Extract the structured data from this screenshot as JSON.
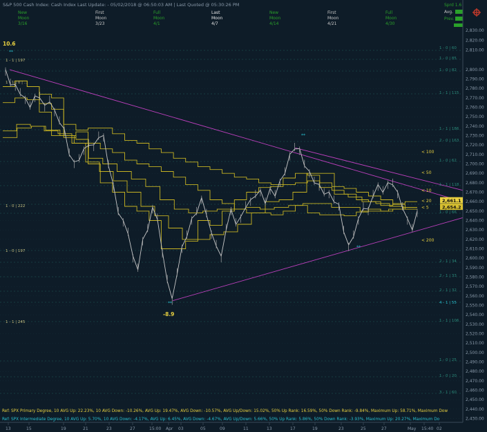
{
  "header": {
    "title": "S&P 500 Cash Index:  Cash Index  Last Update: - 05/02/2018 @ 06:50:03 AM | Last Quoted @ 05:30:26 PM",
    "right_labels": [
      "Sprd 1.6",
      "Avg.",
      "Prev."
    ]
  },
  "moon_phases": [
    {
      "phase": "New",
      "word": "Moon",
      "date": "3/16",
      "color": "#2aa02a"
    },
    {
      "phase": "First",
      "word": "Moon",
      "date": "3/23",
      "color": "#c8c8c8"
    },
    {
      "phase": "Full",
      "word": "Moon",
      "date": "4/1",
      "color": "#2aa02a"
    },
    {
      "phase": "Last",
      "word": "Moon",
      "date": "4/7",
      "color": "#e8e8e8"
    },
    {
      "phase": "New",
      "word": "Moon",
      "date": "4/14",
      "color": "#2aa02a"
    },
    {
      "phase": "First",
      "word": "Moon",
      "date": "4/21",
      "color": "#c8c8c8"
    },
    {
      "phase": "Full",
      "word": "Moon",
      "date": "4/30",
      "color": "#2aa02a"
    }
  ],
  "annotations": {
    "high_value": "10.6",
    "low_value": "-8.9",
    "ma_labels": [
      "< 100",
      "< 50",
      "< 10",
      "< 20",
      "< 5",
      "< 200"
    ],
    "price_tags": [
      "2,661.1",
      "2,654.2"
    ],
    "marker": "**"
  },
  "fib_labels": {
    "left": [
      "1 - 1 | 197",
      "1 - 1 | 0 | ...",
      "1 - 0 | 222",
      "1 - 0 | 197",
      "1 - 1 | 245"
    ],
    "right": [
      "1 - 0 | 60",
      "1 - 0 | 85",
      "1 - 0 | 82",
      "1 - 1 | 115",
      "1 - 1 | 186",
      "2 - 0 | 163",
      "1 - 0 | 62",
      "1 - 1 | 118",
      "1 - 0 | 66",
      "2 - 1 | 34",
      "2 - 1 | 33",
      "2 - 1 | 32",
      "4 - 1 | 55",
      "1 - 1 | 106",
      "1 - 0 | 25",
      "1 - 0 | 20",
      "3 - 1 | 60"
    ]
  },
  "footer": {
    "line1": "Ref: SPX Primary Degree, 10 AVG Up: 22.23%, 10 AVG Down: -10.26%, AVG Up: 19.47%, AVG Down: -10.57%, AVG Up/Down: 15.02%, 50%  Up Rank: 16.59%, 50% Down Rank: -9.84%, Maximum Up: 58.71%, Maximum Dow",
    "line2": "Ref: SPX Intermediate Degree, 10 AVG Up: 5.70%, 10 AVG Down: -4.17%, AVG Up: 6.45%, AVG Down: -4.67%, AVG Up/Down: 5.66%, 50%  Up Rank: 5.86%, 50% Down Rank: -3.93%, Maximum Up: 20.27%, Maximum Do"
  },
  "chart_data": {
    "type": "line",
    "ylim": [
      2430,
      2810
    ],
    "ytick_labels": [
      "2,800.00",
      "2,790.00",
      "2,780.00",
      "2,770.00",
      "2,760.00",
      "2,750.00",
      "2,740.00",
      "2,730.00",
      "2,720.00",
      "2,710.00",
      "2,700.00",
      "2,690.00",
      "2,680.00",
      "2,670.00",
      "2,660.00",
      "2,650.00",
      "2,640.00",
      "2,630.00",
      "2,620.00",
      "2,610.00",
      "2,600.00",
      "2,590.00",
      "2,580.00",
      "2,570.00",
      "2,560.00",
      "2,550.00",
      "2,540.00",
      "2,530.00",
      "2,520.00",
      "2,510.00",
      "2,500.00",
      "2,490.00",
      "2,480.00",
      "2,470.00",
      "2,460.00",
      "2,450.00",
      "2,440.00",
      "2,430.00"
    ],
    "yticks": [
      2800,
      2790,
      2780,
      2770,
      2760,
      2750,
      2740,
      2730,
      2720,
      2710,
      2700,
      2690,
      2680,
      2670,
      2660,
      2650,
      2640,
      2630,
      2620,
      2610,
      2600,
      2590,
      2580,
      2570,
      2560,
      2550,
      2540,
      2530,
      2520,
      2510,
      2500,
      2490,
      2480,
      2470,
      2460,
      2450,
      2440,
      2430
    ],
    "top_tick_labels": [
      "2,830.00",
      "2,820.00",
      "2,810.00"
    ],
    "top_ticks": [
      2830,
      2820,
      2810
    ],
    "xtick_labels": [
      "13",
      "15",
      "19",
      "21",
      "23",
      "27",
      "15:00",
      "Apr",
      "03",
      "05",
      "09",
      "11",
      "13",
      "17",
      "19",
      "23",
      "25",
      "27",
      "May",
      "15:40",
      "02"
    ],
    "price_series": {
      "name": "SPX",
      "values": [
        2798,
        2786,
        2782,
        2776,
        2768,
        2762,
        2770,
        2772,
        2760,
        2768,
        2755,
        2746,
        2735,
        2712,
        2700,
        2706,
        2714,
        2722,
        2718,
        2730,
        2728,
        2700,
        2676,
        2650,
        2638,
        2628,
        2600,
        2590,
        2618,
        2632,
        2652,
        2643,
        2605,
        2578,
        2555,
        2585,
        2610,
        2625,
        2640,
        2650,
        2662,
        2648,
        2625,
        2615,
        2600,
        2632,
        2650,
        2638,
        2642,
        2656,
        2660,
        2668,
        2670,
        2660,
        2672,
        2668,
        2680,
        2692,
        2708,
        2718,
        2714,
        2700,
        2690,
        2682,
        2676,
        2670,
        2668,
        2662,
        2655,
        2630,
        2612,
        2625,
        2640,
        2655,
        2650,
        2668,
        2676,
        2672,
        2678,
        2680,
        2668,
        2655,
        2640,
        2632,
        2648
      ]
    },
    "ma_series": [
      {
        "values": [
          2782,
          2788,
          2782,
          2774,
          2770,
          2742,
          2736,
          2738,
          2738,
          2732,
          2725,
          2722,
          2716,
          2712,
          2706,
          2702,
          2697,
          2694,
          2690,
          2686,
          2684,
          2680,
          2678,
          2678,
          2680,
          2682,
          2680,
          2676,
          2674,
          2670,
          2666,
          2662,
          2657,
          2654
        ]
      },
      {
        "values": [
          2782,
          2788,
          2782,
          2764,
          2758,
          2730,
          2726,
          2722,
          2716,
          2712,
          2704,
          2700,
          2697,
          2692,
          2686,
          2678,
          2672,
          2662,
          2658,
          2652,
          2648,
          2648,
          2646,
          2650,
          2656,
          2648,
          2646,
          2646,
          2645,
          2649,
          2652,
          2650,
          2652,
          2654
        ]
      },
      {
        "values": [
          2765,
          2770,
          2768,
          2755,
          2730,
          2728,
          2734,
          2700,
          2680,
          2670,
          2655,
          2650,
          2640,
          2610,
          2610,
          2618,
          2640,
          2635,
          2650,
          2662,
          2670,
          2675,
          2676,
          2685,
          2690,
          2688,
          2675,
          2672,
          2668,
          2662,
          2660,
          2656,
          2658,
          2660
        ]
      },
      {
        "values": [
          2735,
          2742,
          2740,
          2735,
          2732,
          2722,
          2702,
          2692,
          2682,
          2670,
          2655,
          2645,
          2632,
          2620,
          2620,
          2625,
          2628,
          2636,
          2648,
          2660,
          2662,
          2670,
          2690,
          2690,
          2668,
          2665,
          2660,
          2658,
          2655,
          2652
        ]
      },
      {
        "values": [
          2728,
          2738,
          2740,
          2736,
          2730,
          2722,
          2706,
          2700,
          2692,
          2684,
          2676,
          2662,
          2652,
          2648,
          2650,
          2652,
          2652,
          2654,
          2652,
          2654,
          2656,
          2658,
          2658,
          2654,
          2654,
          2650,
          2650,
          2652,
          2654
        ]
      }
    ],
    "trendlines": [
      {
        "from": [
          0,
          2800
        ],
        "to": [
          1,
          2660
        ]
      },
      {
        "from": [
          0.63,
          2717
        ],
        "to": [
          1,
          2672
        ]
      },
      {
        "from": [
          0.36,
          2555
        ],
        "to": [
          1,
          2643
        ]
      }
    ],
    "ma_levels": [
      {
        "label": "< 100",
        "value": 2713
      },
      {
        "label": "< 50",
        "value": 2691
      },
      {
        "label": "< 10",
        "value": 2672
      },
      {
        "label": "< 20",
        "value": 2661
      },
      {
        "label": "< 5",
        "value": 2654
      },
      {
        "label": "< 200",
        "value": 2619
      }
    ],
    "price_tags": [
      {
        "label": "2,661.1",
        "value": 2661.1
      },
      {
        "label": "2,654.2",
        "value": 2654.2
      }
    ]
  }
}
